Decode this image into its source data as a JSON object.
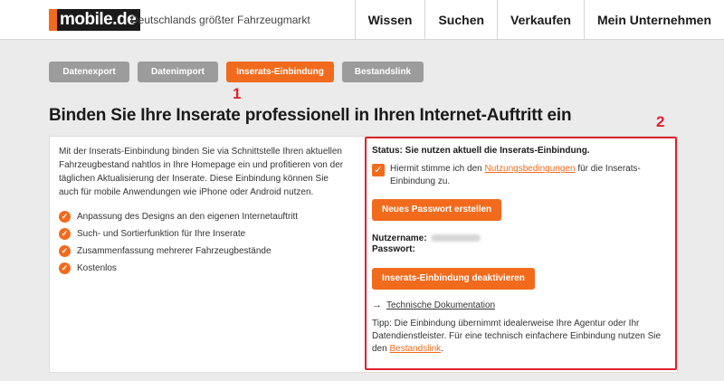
{
  "header": {
    "logo_text": "mobile.de",
    "tagline": "Deutschlands größter Fahrzeugmarkt",
    "nav": [
      "Wissen",
      "Suchen",
      "Verkaufen",
      "Mein Unternehmen"
    ]
  },
  "tabs": [
    {
      "label": "Datenexport",
      "active": false
    },
    {
      "label": "Datenimport",
      "active": false
    },
    {
      "label": "Inserats-Einbindung",
      "active": true
    },
    {
      "label": "Bestandslink",
      "active": false
    }
  ],
  "annotations": {
    "marker1": "1",
    "marker2": "2"
  },
  "page_title": "Binden Sie Ihre Inserate professionell in Ihren Internet-Auftritt ein",
  "intro": "Mit der Inserats-Einbindung binden Sie via Schnittstelle Ihren aktuellen Fahrzeugbestand nahtlos in Ihre Homepage ein und profitieren von der täglichen Aktualisierung der Inserate. Diese Einbindung können Sie auch für mobile Anwendungen wie iPhone oder Android nutzen.",
  "features": [
    "Anpassung des Designs an den eigenen Internetauftritt",
    "Such- und Sortierfunktion für Ihre Inserate",
    "Zusammenfassung mehrerer Fahrzeugbestände",
    "Kostenlos"
  ],
  "panel": {
    "status": "Status: Sie nutzen aktuell die Inserats-Einbindung.",
    "consent_before": "Hiermit stimme ich den ",
    "consent_link": "Nutzungsbedingungen",
    "consent_after": " für die Inserats-Einbindung zu.",
    "consent_checked": true,
    "new_password_button": "Neues Passwort erstellen",
    "username_label": "Nutzername:",
    "password_label": "Passwort:",
    "deactivate_button": "Inserats-Einbindung deaktivieren",
    "doc_arrow": "→",
    "doc_link": "Technische Dokumentation",
    "tip_before": "Tipp: Die Einbindung übernimmt idealerweise Ihre Agentur oder Ihr Datendienstleister. Für eine technisch einfachere Einbindung nutzen Sie den ",
    "tip_link": "Bestandslink",
    "tip_after": "."
  },
  "colors": {
    "accent": "#f26b1d",
    "tab_inactive": "#9c9c9c",
    "annotation_red": "#e0202c"
  }
}
